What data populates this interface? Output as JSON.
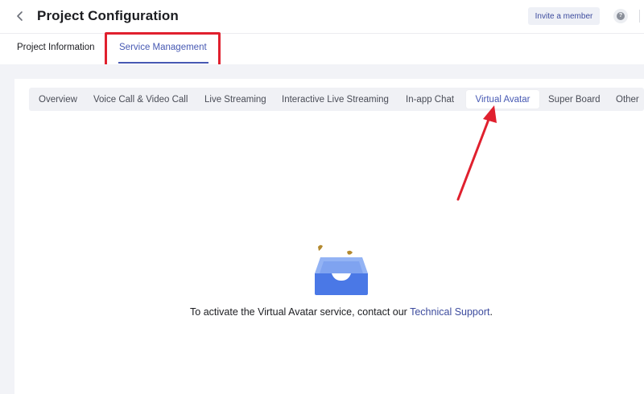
{
  "header": {
    "title": "Project Configuration",
    "invite_label": "Invite a member",
    "help_glyph": "?"
  },
  "main_tabs": [
    {
      "label": "Project Information",
      "active": false
    },
    {
      "label": "Service Management",
      "active": true
    }
  ],
  "service_tabs": [
    {
      "label": "Overview",
      "active": false
    },
    {
      "label": "Voice Call & Video Call",
      "active": false
    },
    {
      "label": "Live Streaming",
      "active": false
    },
    {
      "label": "Interactive Live Streaming",
      "active": false
    },
    {
      "label": "In-app Chat",
      "active": false
    },
    {
      "label": "Virtual Avatar",
      "active": true
    },
    {
      "label": "Super Board",
      "active": false
    },
    {
      "label": "Other",
      "active": false
    }
  ],
  "empty_state": {
    "message_prefix": "To activate the Virtual Avatar service, contact our ",
    "link_text": "Technical Support",
    "message_suffix": "."
  },
  "icons": {
    "back": "chevron-left-icon",
    "help": "question-circle-icon",
    "empty": "empty-inbox-icon"
  },
  "colors": {
    "accent": "#4759b3",
    "link": "#3d4c9e",
    "annotation": "#e0202e",
    "tray_blue": "#4a78e6",
    "tray_light": "#93b3f4"
  }
}
